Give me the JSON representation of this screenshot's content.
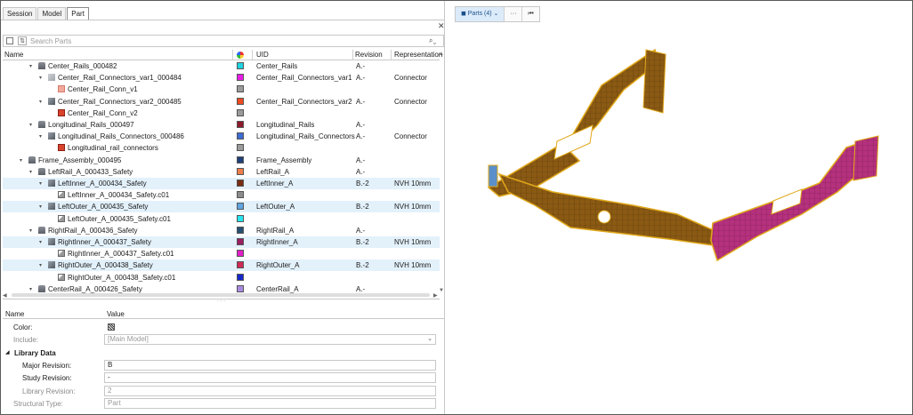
{
  "tabs": [
    "Session",
    "Model",
    "Part"
  ],
  "active_tab": "Part",
  "search": {
    "placeholder": "Search Parts"
  },
  "columns": {
    "name": "Name",
    "uid": "UID",
    "revision": "Revision",
    "representation": "Representation"
  },
  "rows": [
    {
      "name": "Center_Rails_000482",
      "uid": "Center_Rails",
      "rev": "A.-",
      "rep": "",
      "color": "#1fd3df",
      "kind": "asm"
    },
    {
      "name": "Center_Rail_Connectors_var1_000484",
      "uid": "Center_Rail_Connectors_var1",
      "rev": "A.-",
      "rep": "Connector",
      "color": "#e61ee6",
      "kind": "part-light"
    },
    {
      "name": "Center_Rail_Conn_v1",
      "uid": "",
      "rev": "",
      "rep": "",
      "color": "#9b9b9b",
      "kind": "conn-light"
    },
    {
      "name": "Center_Rail_Connectors_var2_000485",
      "uid": "Center_Rail_Connectors_var2",
      "rev": "A.-",
      "rep": "Connector",
      "color": "#ee4b22",
      "kind": "part"
    },
    {
      "name": "Center_Rail_Conn_v2",
      "uid": "",
      "rev": "",
      "rep": "",
      "color": "#9b9b9b",
      "kind": "conn"
    },
    {
      "name": "Longitudinal_Rails_000497",
      "uid": "Longitudinal_Rails",
      "rev": "A.-",
      "rep": "",
      "color": "#8d1a2a",
      "kind": "asm"
    },
    {
      "name": "Longitudinal_Rails_Connectors_000486",
      "uid": "Longitudinal_Rails_Connectors",
      "rev": "A.-",
      "rep": "Connector",
      "color": "#3d6bd1",
      "kind": "part"
    },
    {
      "name": "Longitudinal_rail_connectors",
      "uid": "",
      "rev": "",
      "rep": "",
      "color": "#9b9b9b",
      "kind": "conn"
    },
    {
      "name": "Frame_Assembly_000495",
      "uid": "Frame_Assembly",
      "rev": "A.-",
      "rep": "",
      "color": "#1f3f78",
      "kind": "asm"
    },
    {
      "name": "LeftRail_A_000433_Safety",
      "uid": "LeftRail_A",
      "rev": "A.-",
      "rep": "",
      "color": "#f07c4a",
      "kind": "asm"
    },
    {
      "name": "LeftInner_A_000434_Safety",
      "uid": "LeftInner_A",
      "rev": "B.-2",
      "rep": "NVH 10mm",
      "color": "#7a2d12",
      "kind": "part",
      "sel": true
    },
    {
      "name": "LeftInner_A_000434_Safety.c01",
      "uid": "",
      "rev": "",
      "rep": "",
      "color": "#8c8c8c",
      "kind": "comp"
    },
    {
      "name": "LeftOuter_A_000435_Safety",
      "uid": "LeftOuter_A",
      "rev": "B.-2",
      "rep": "NVH 10mm",
      "color": "#5fa6e0",
      "kind": "part",
      "sel": true
    },
    {
      "name": "LeftOuter_A_000435_Safety.c01",
      "uid": "",
      "rev": "",
      "rep": "",
      "color": "#27e6f0",
      "kind": "comp"
    },
    {
      "name": "RightRail_A_000436_Safety",
      "uid": "RightRail_A",
      "rev": "A.-",
      "rep": "",
      "color": "#274f73",
      "kind": "asm"
    },
    {
      "name": "RightInner_A_000437_Safety",
      "uid": "RightInner_A",
      "rev": "B.-2",
      "rep": "NVH 10mm",
      "color": "#9a1f63",
      "kind": "part",
      "sel": true
    },
    {
      "name": "RightInner_A_000437_Safety.c01",
      "uid": "",
      "rev": "",
      "rep": "",
      "color": "#e01fc8",
      "kind": "comp"
    },
    {
      "name": "RightOuter_A_000438_Safety",
      "uid": "RightOuter_A",
      "rev": "B.-2",
      "rep": "NVH 10mm",
      "color": "#cf2a57",
      "kind": "part",
      "sel": true
    },
    {
      "name": "RightOuter_A_000438_Safety.c01",
      "uid": "",
      "rev": "",
      "rep": "",
      "color": "#1428c8",
      "kind": "comp"
    },
    {
      "name": "CenterRail_A_000426_Safety",
      "uid": "CenterRail_A",
      "rev": "A.-",
      "rep": "",
      "color": "#a98ae0",
      "kind": "asm"
    }
  ],
  "props": {
    "name_header": "Name",
    "value_header": "Value",
    "color_label": "Color:",
    "include_label": "Include:",
    "include_value": "[Main Model]",
    "section": "Library Data",
    "major_label": "Major Revision:",
    "major_value": "B",
    "study_label": "Study Revision:",
    "study_value": "-",
    "library_label": "Library Revision:",
    "library_value": "2",
    "structural_label": "Structural Type:",
    "structural_value": "Part"
  },
  "viewbar": {
    "parts_label": "Parts (4)",
    "more": "···",
    "end": "⏮"
  },
  "colors": {
    "accent": "#dcebfa",
    "selection": "#e3f1fb",
    "mesh_brown": "#8a5a14",
    "mesh_magenta": "#b5317d",
    "mesh_edge": "#e0a81a"
  }
}
